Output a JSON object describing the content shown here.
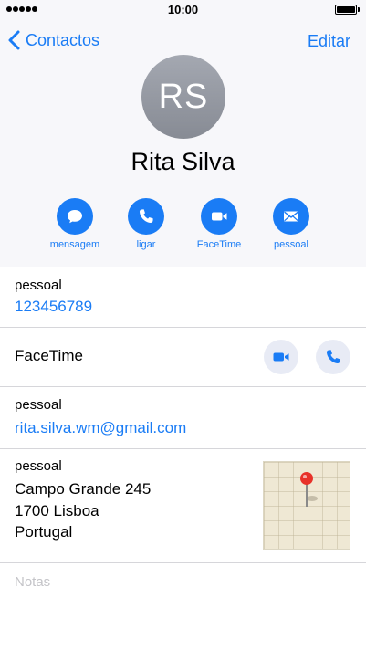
{
  "status_bar": {
    "time": "10:00"
  },
  "nav": {
    "back_label": "Contactos",
    "edit_label": "Editar"
  },
  "contact": {
    "initials": "RS",
    "name": "Rita Silva"
  },
  "actions": [
    {
      "label": "mensagem",
      "icon": "message-icon"
    },
    {
      "label": "ligar",
      "icon": "phone-icon"
    },
    {
      "label": "FaceTime",
      "icon": "video-icon"
    },
    {
      "label": "pessoal",
      "icon": "mail-icon"
    }
  ],
  "phone": {
    "caption": "pessoal",
    "value": "123456789"
  },
  "facetime": {
    "label": "FaceTime"
  },
  "email": {
    "caption": "pessoal",
    "value": "rita.silva.wm@gmail.com"
  },
  "address": {
    "caption": "pessoal",
    "line1": "Campo Grande 245",
    "line2": "1700 Lisboa",
    "line3": "Portugal"
  },
  "notes": {
    "placeholder": "Notas"
  },
  "colors": {
    "accent": "#1a7cf5",
    "header_bg": "#f7f7fa",
    "avatar": "#9a9ea7"
  }
}
